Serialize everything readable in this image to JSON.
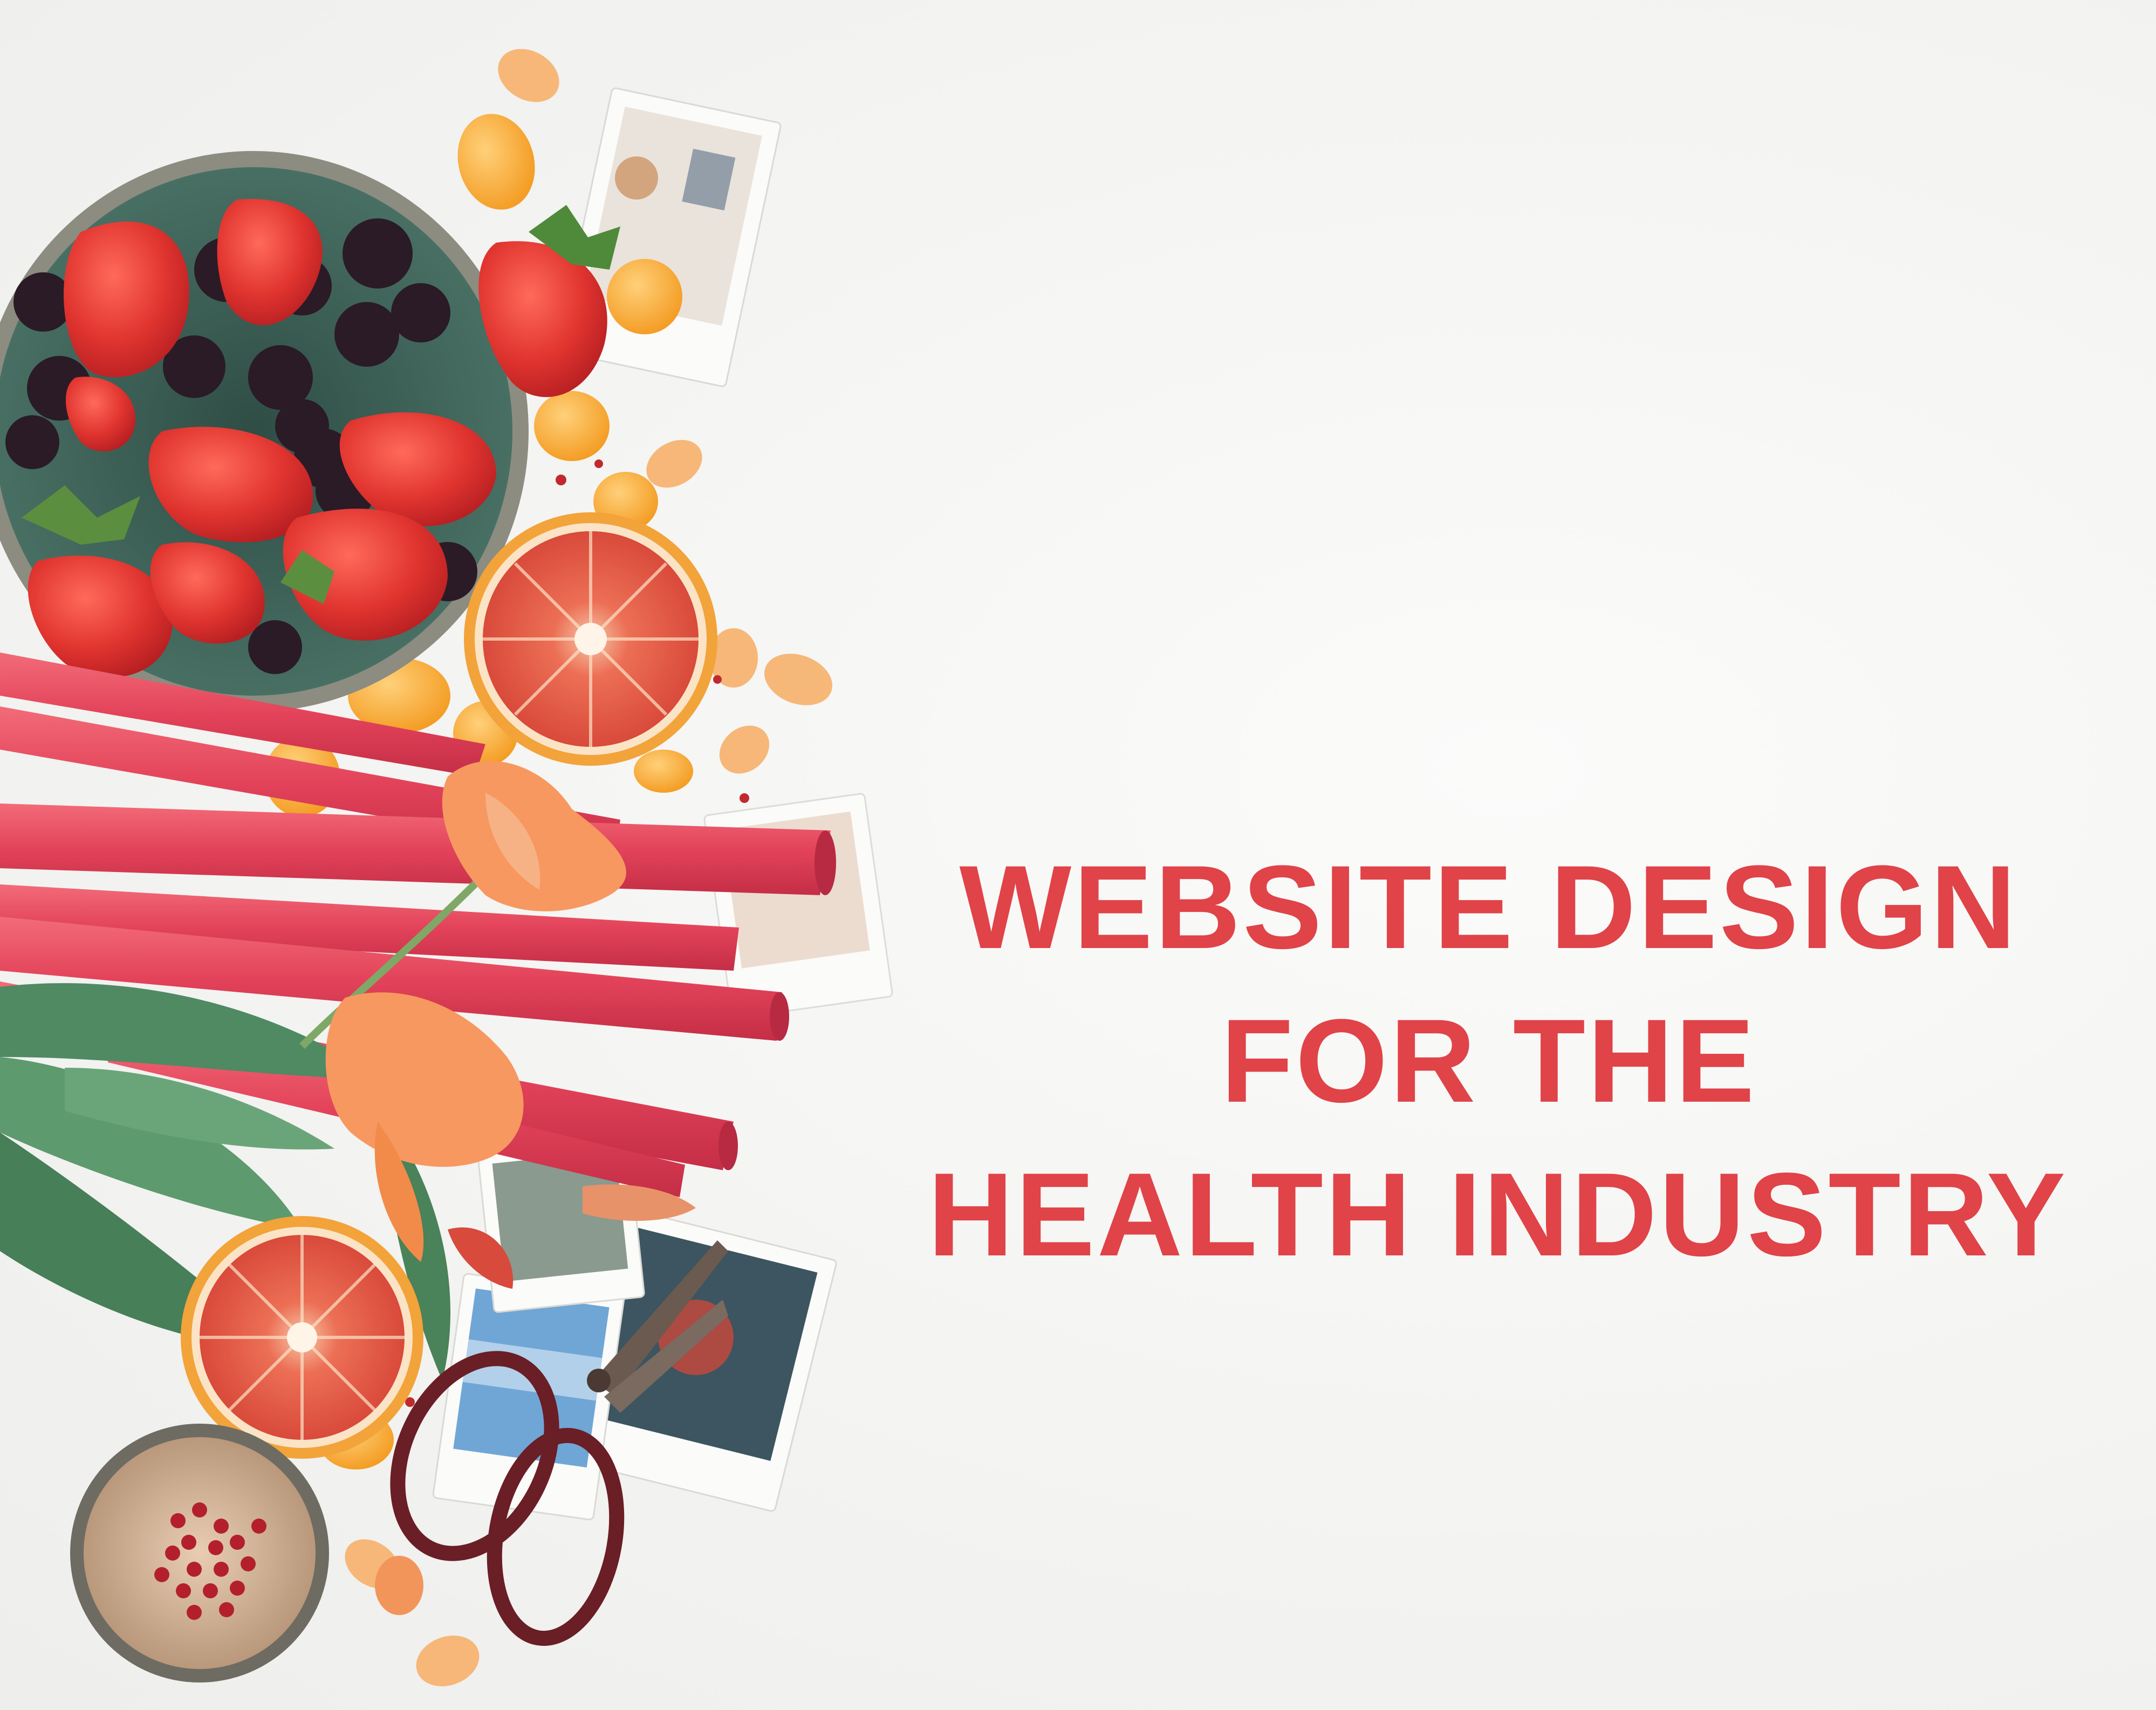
{
  "headline": {
    "lines": [
      "WEBSITE DESIGN",
      "FOR THE",
      "HEALTH INDUSTRY"
    ],
    "color": "#e04348"
  },
  "photo": {
    "subjects": [
      "fruit-bowl",
      "strawberry",
      "blackberry",
      "blood-orange",
      "kumquat",
      "rhubarb",
      "tulip",
      "polaroid-photo",
      "scissors",
      "peppercorn-bowl",
      "petal"
    ]
  },
  "colors": {
    "background": "#f4f4f2",
    "strawberry": "#e0342f",
    "blackberry": "#2a1b26",
    "rhubarb": "#e4495a",
    "orange_rind": "#f2a33a",
    "orange_flesh": "#e25a44",
    "leaf": "#4f8a62",
    "bowl": "#3f6358",
    "tulip": "#f79860",
    "scissors": "#6a1e25"
  }
}
